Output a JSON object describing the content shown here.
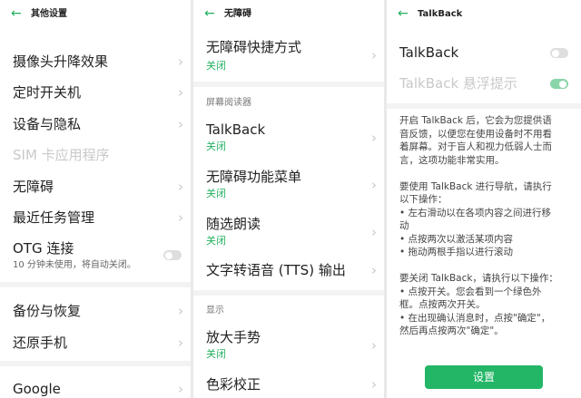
{
  "panel1": {
    "title": "其他设置",
    "items": [
      {
        "label": "摄像头升降效果"
      },
      {
        "label": "定时开关机"
      },
      {
        "label": "设备与隐私"
      },
      {
        "label": "SIM 卡应用程序"
      },
      {
        "label": "无障碍"
      },
      {
        "label": "最近任务管理"
      },
      {
        "label": "OTG 连接",
        "sub": "10 分钟未使用，将自动关闭。"
      },
      {
        "label": "备份与恢复"
      },
      {
        "label": "还原手机"
      },
      {
        "label": "Google"
      }
    ]
  },
  "panel2": {
    "title": "无障碍",
    "items": [
      {
        "label": "无障碍快捷方式",
        "sub": "关闭"
      },
      {
        "label": "TalkBack",
        "sub": "关闭"
      },
      {
        "label": "无障碍功能菜单",
        "sub": "关闭"
      },
      {
        "label": "随选朗读",
        "sub": "关闭"
      },
      {
        "label": "文字转语音 (TTS) 输出"
      },
      {
        "label": "放大手势",
        "sub": "关闭"
      },
      {
        "label": "色彩校正"
      }
    ],
    "section_screen_reader": "屏幕阅读器",
    "section_display": "显示"
  },
  "panel3": {
    "title": "TalkBack",
    "talkback_label": "TalkBack",
    "float_hint_label": "TalkBack 悬浮提示",
    "desc_lines": [
      "开启 TalkBack 后，它会为您提供语",
      "音反馈，以便您在使用设备时不用看",
      "着屏幕。对于盲人和视力低弱人士而",
      "言，这项功能非常实用。",
      "",
      "要使用 TalkBack 进行导航，请执行",
      "以下操作：",
      "• 左右滑动以在各项内容之间进行移",
      "动",
      "• 点按两次以激活某项内容",
      "• 拖动两根手指以进行滚动",
      "",
      "要关闭 TalkBack，请执行以下操作：",
      "• 点按开关。您会看到一个绿色外",
      "框。点按两次开关。",
      "• 在出现确认消息时，点按\"确定\"，",
      "然后再点按两次\"确定\"。"
    ],
    "settings_button": "设置"
  },
  "icons": {
    "back": "back-arrow-icon",
    "chevron": "chevron-right-icon"
  },
  "colors": {
    "accent": "#22b060",
    "button": "#23b667"
  }
}
